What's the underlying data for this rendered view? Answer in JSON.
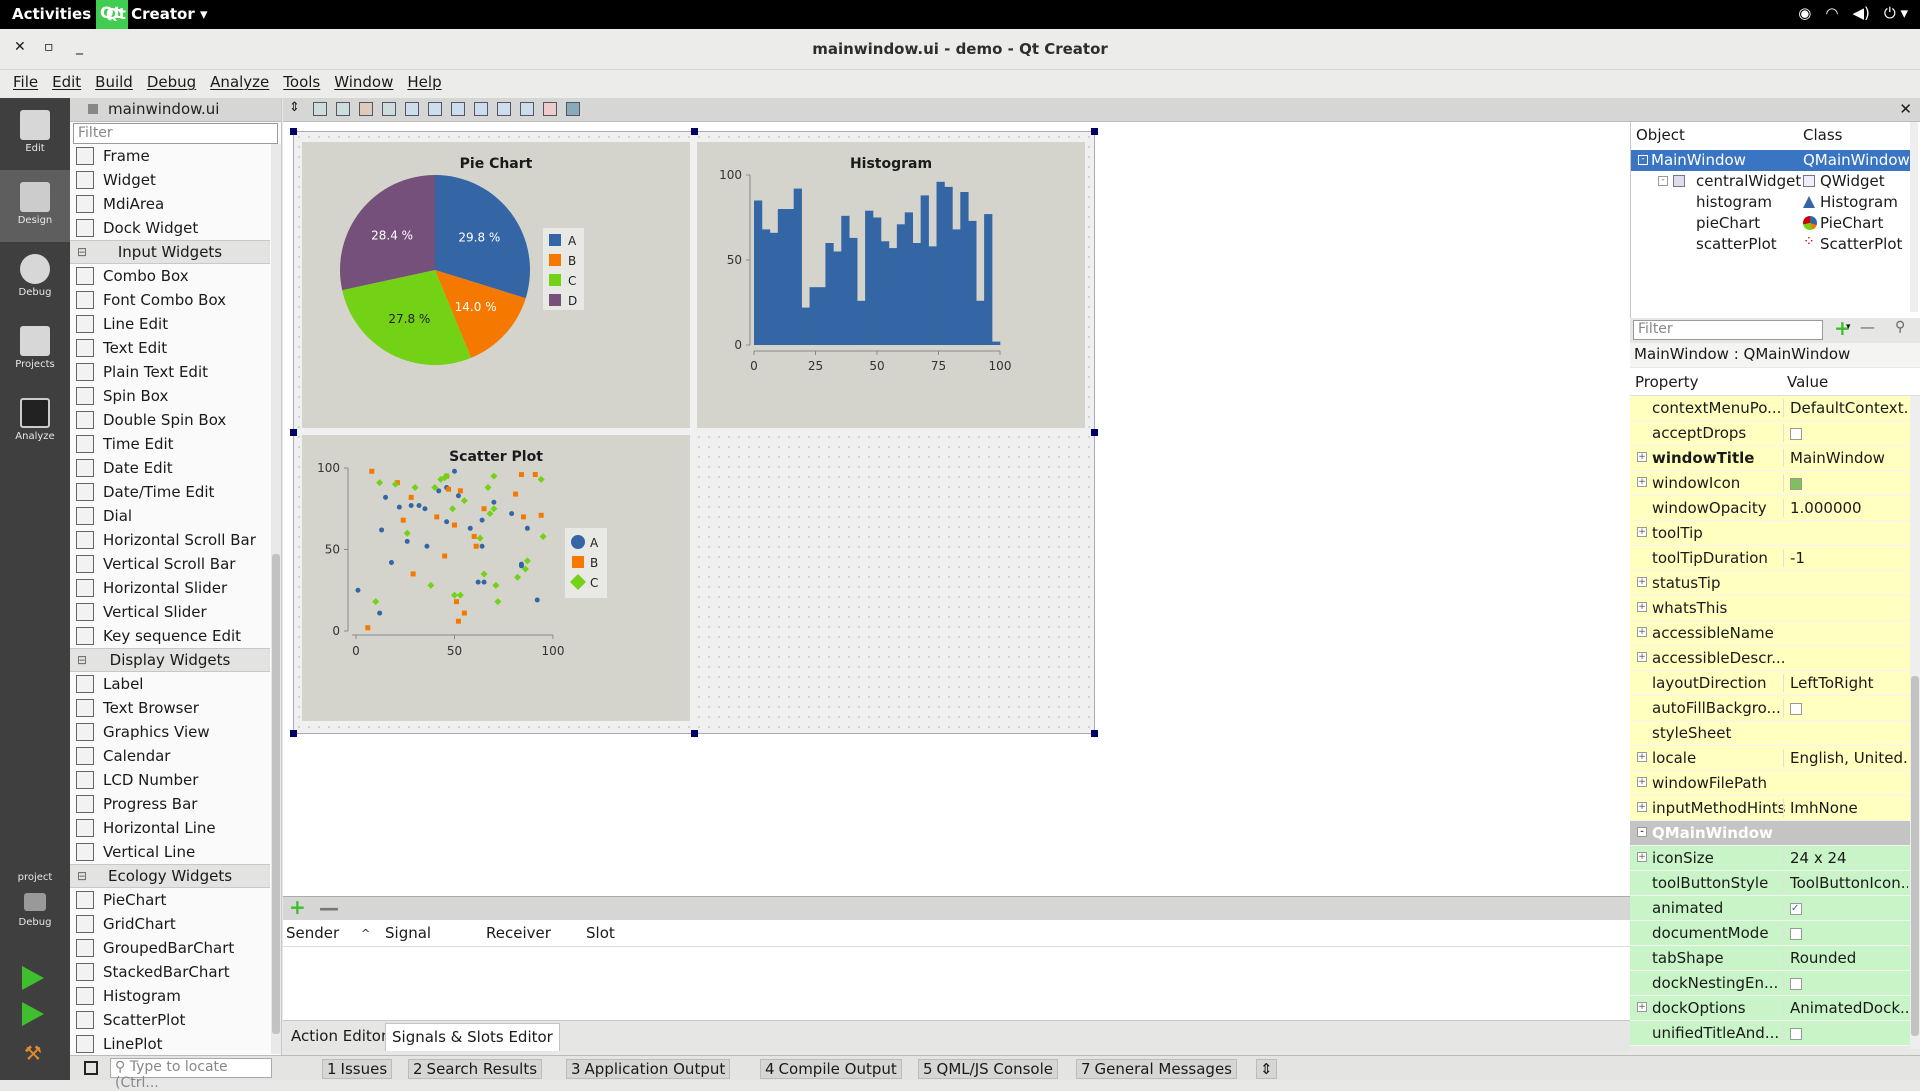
{
  "topbar": {
    "activities": "Activities",
    "app": "Qt Creator"
  },
  "window": {
    "title": "mainwindow.ui - demo - Qt Creator"
  },
  "menu": [
    "File",
    "Edit",
    "Build",
    "Debug",
    "Analyze",
    "Tools",
    "Window",
    "Help"
  ],
  "modes": [
    {
      "label": "Edit"
    },
    {
      "label": "Design"
    },
    {
      "label": "Debug"
    },
    {
      "label": "Projects"
    },
    {
      "label": "Analyze"
    }
  ],
  "kit": {
    "project": "project",
    "debug": "Debug"
  },
  "editor": {
    "file": "mainwindow.ui"
  },
  "widgetbox": {
    "filter_placeholder": "Filter",
    "groups": [
      {
        "name": "",
        "items": [
          "Frame",
          "Widget",
          "MdiArea",
          "Dock Widget"
        ]
      },
      {
        "name": "Input Widgets",
        "items": [
          "Combo Box",
          "Font Combo Box",
          "Line Edit",
          "Text Edit",
          "Plain Text Edit",
          "Spin Box",
          "Double Spin Box",
          "Time Edit",
          "Date Edit",
          "Date/Time Edit",
          "Dial",
          "Horizontal Scroll Bar",
          "Vertical Scroll Bar",
          "Horizontal Slider",
          "Vertical Slider",
          "Key sequence Edit"
        ]
      },
      {
        "name": "Display Widgets",
        "items": [
          "Label",
          "Text Browser",
          "Graphics View",
          "Calendar",
          "LCD Number",
          "Progress Bar",
          "Horizontal Line",
          "Vertical Line"
        ]
      },
      {
        "name": "Ecology Widgets",
        "items": [
          "PieChart",
          "GridChart",
          "GroupedBarChart",
          "StackedBarChart",
          "Histogram",
          "ScatterPlot",
          "LinePlot"
        ]
      }
    ]
  },
  "chart_data": [
    {
      "type": "pie",
      "title": "Pie Chart",
      "categories": [
        "A",
        "B",
        "C",
        "D"
      ],
      "values": [
        29.8,
        14.0,
        27.8,
        28.4
      ],
      "labels": [
        "29.8 %",
        "14.0 %",
        "27.8 %",
        "28.4 %"
      ],
      "colors": [
        "#3465a4",
        "#f57900",
        "#73d216",
        "#75507b"
      ]
    },
    {
      "type": "bar",
      "title": "Histogram",
      "xlim": [
        0,
        100
      ],
      "ylim": [
        0,
        100
      ],
      "xticks": [
        "0",
        "25",
        "50",
        "75",
        "100"
      ],
      "yticks": [
        "0",
        "50",
        "100"
      ],
      "values": [
        85,
        68,
        66,
        80,
        80,
        92,
        22,
        34,
        34,
        60,
        55,
        76,
        63,
        26,
        79,
        75,
        61,
        57,
        71,
        78,
        60,
        88,
        58,
        96,
        93,
        68,
        90,
        73,
        26,
        77,
        2
      ],
      "color": "#3465a4"
    },
    {
      "type": "scatter",
      "title": "Scatter Plot",
      "xlim": [
        0,
        100
      ],
      "ylim": [
        0,
        100
      ],
      "xticks": [
        "0",
        "50",
        "100"
      ],
      "yticks": [
        "0",
        "50",
        "100"
      ],
      "series": [
        {
          "name": "A",
          "color": "#3465a4",
          "shape": "circle",
          "points": [
            [
              1,
              25
            ],
            [
              12,
              11
            ],
            [
              13,
              62
            ],
            [
              15,
              82
            ],
            [
              18,
              42
            ],
            [
              22,
              76
            ],
            [
              26,
              55
            ],
            [
              28,
              77
            ],
            [
              32,
              77
            ],
            [
              35,
              75
            ],
            [
              36,
              52
            ],
            [
              42,
              86
            ],
            [
              46,
              88
            ],
            [
              46,
              67
            ],
            [
              50,
              98
            ],
            [
              52,
              83
            ],
            [
              58,
              63
            ],
            [
              62,
              30
            ],
            [
              64,
              52
            ],
            [
              64,
              68
            ],
            [
              65,
              30
            ],
            [
              70,
              79
            ],
            [
              79,
              72
            ],
            [
              84,
              40
            ],
            [
              84,
              41
            ],
            [
              87,
              63
            ],
            [
              92,
              19
            ]
          ]
        },
        {
          "name": "B",
          "color": "#f57900",
          "shape": "square",
          "points": [
            [
              6,
              2
            ],
            [
              8,
              98
            ],
            [
              21,
              91
            ],
            [
              24,
              68
            ],
            [
              28,
              82
            ],
            [
              29,
              35
            ],
            [
              41,
              70
            ],
            [
              45,
              46
            ],
            [
              46,
              95
            ],
            [
              47,
              87
            ],
            [
              50,
              65
            ],
            [
              51,
              18
            ],
            [
              52,
              6
            ],
            [
              53,
              86
            ],
            [
              55,
              11
            ],
            [
              60,
              58
            ],
            [
              61,
              52
            ],
            [
              65,
              75
            ],
            [
              81,
              84
            ],
            [
              84,
              96
            ],
            [
              85,
              70
            ],
            [
              91,
              96
            ],
            [
              94,
              71
            ]
          ]
        },
        {
          "name": "C",
          "color": "#73d216",
          "shape": "diamond",
          "points": [
            [
              10,
              18
            ],
            [
              12,
              91
            ],
            [
              20,
              90
            ],
            [
              26,
              60
            ],
            [
              30,
              88
            ],
            [
              38,
              28
            ],
            [
              40,
              88
            ],
            [
              43,
              93
            ],
            [
              45,
              94
            ],
            [
              46,
              95
            ],
            [
              49,
              75
            ],
            [
              50,
              22
            ],
            [
              53,
              22
            ],
            [
              55,
              80
            ],
            [
              63,
              57
            ],
            [
              65,
              35
            ],
            [
              67,
              88
            ],
            [
              68,
              72
            ],
            [
              70,
              95
            ],
            [
              70,
              75
            ],
            [
              71,
              28
            ],
            [
              72,
              18
            ],
            [
              82,
              33
            ],
            [
              86,
              38
            ],
            [
              87,
              43
            ],
            [
              94,
              93
            ],
            [
              95,
              58
            ]
          ]
        }
      ]
    }
  ],
  "signals": {
    "columns": [
      "Sender",
      "Signal",
      "Receiver",
      "Slot"
    ],
    "tabs": [
      "Action Editor",
      "Signals & Slots Editor"
    ]
  },
  "objects": {
    "headers": [
      "Object",
      "Class"
    ],
    "rows": [
      {
        "name": "MainWindow",
        "cls": "QMainWindow"
      },
      {
        "name": "centralWidget",
        "cls": "QWidget"
      },
      {
        "name": "histogram",
        "cls": "Histogram"
      },
      {
        "name": "pieChart",
        "cls": "PieChart"
      },
      {
        "name": "scatterPlot",
        "cls": "ScatterPlot"
      }
    ]
  },
  "properties": {
    "filter_placeholder": "Filter",
    "class_line": "MainWindow : QMainWindow",
    "headers": [
      "Property",
      "Value"
    ],
    "rows": [
      {
        "name": "contextMenuPo...",
        "value": "DefaultContext...",
        "bg": "y",
        "exp": false,
        "bold": false,
        "check": false
      },
      {
        "name": "acceptDrops",
        "value": "",
        "bg": "y",
        "exp": false,
        "bold": false,
        "check": true
      },
      {
        "name": "windowTitle",
        "value": "MainWindow",
        "bg": "y",
        "exp": true,
        "bold": true,
        "check": false
      },
      {
        "name": "windowIcon",
        "value": "",
        "bg": "y",
        "exp": true,
        "bold": false,
        "check": false
      },
      {
        "name": "windowOpacity",
        "value": "1.000000",
        "bg": "y",
        "exp": false,
        "bold": false,
        "check": false
      },
      {
        "name": "toolTip",
        "value": "",
        "bg": "y",
        "exp": true,
        "bold": false,
        "check": false
      },
      {
        "name": "toolTipDuration",
        "value": "-1",
        "bg": "y",
        "exp": false,
        "bold": false,
        "check": false
      },
      {
        "name": "statusTip",
        "value": "",
        "bg": "y",
        "exp": true,
        "bold": false,
        "check": false
      },
      {
        "name": "whatsThis",
        "value": "",
        "bg": "y",
        "exp": true,
        "bold": false,
        "check": false
      },
      {
        "name": "accessibleName",
        "value": "",
        "bg": "y",
        "exp": true,
        "bold": false,
        "check": false
      },
      {
        "name": "accessibleDescr...",
        "value": "",
        "bg": "y",
        "exp": true,
        "bold": false,
        "check": false
      },
      {
        "name": "layoutDirection",
        "value": "LeftToRight",
        "bg": "y",
        "exp": false,
        "bold": false,
        "check": false
      },
      {
        "name": "autoFillBackgro...",
        "value": "",
        "bg": "y",
        "exp": false,
        "bold": false,
        "check": true
      },
      {
        "name": "styleSheet",
        "value": "",
        "bg": "y",
        "exp": false,
        "bold": false,
        "check": false
      },
      {
        "name": "locale",
        "value": "English, United...",
        "bg": "y",
        "exp": true,
        "bold": false,
        "check": false
      },
      {
        "name": "windowFilePath",
        "value": "",
        "bg": "y",
        "exp": true,
        "bold": false,
        "check": false
      },
      {
        "name": "inputMethodHints",
        "value": "ImhNone",
        "bg": "y",
        "exp": true,
        "bold": false,
        "check": false
      },
      {
        "name": "QMainWindow",
        "value": "",
        "bg": "sec",
        "exp": true,
        "bold": true,
        "check": false
      },
      {
        "name": "iconSize",
        "value": "24 x 24",
        "bg": "g",
        "exp": true,
        "bold": false,
        "check": false
      },
      {
        "name": "toolButtonStyle",
        "value": "ToolButtonIcon...",
        "bg": "g",
        "exp": false,
        "bold": false,
        "check": false
      },
      {
        "name": "animated",
        "value": "",
        "bg": "g",
        "exp": false,
        "bold": false,
        "check": true,
        "checked": true
      },
      {
        "name": "documentMode",
        "value": "",
        "bg": "g",
        "exp": false,
        "bold": false,
        "check": true
      },
      {
        "name": "tabShape",
        "value": "Rounded",
        "bg": "g",
        "exp": false,
        "bold": false,
        "check": false
      },
      {
        "name": "dockNestingEn...",
        "value": "",
        "bg": "g",
        "exp": false,
        "bold": false,
        "check": true
      },
      {
        "name": "dockOptions",
        "value": "AnimatedDock...",
        "bg": "g",
        "exp": true,
        "bold": false,
        "check": false
      },
      {
        "name": "unifiedTitleAnd...",
        "value": "",
        "bg": "g",
        "exp": false,
        "bold": false,
        "check": true
      }
    ]
  },
  "statusbar": {
    "locate_placeholder": "Type to locate (Ctrl...",
    "panes": [
      {
        "num": "1",
        "label": "Issues"
      },
      {
        "num": "2",
        "label": "Search Results"
      },
      {
        "num": "3",
        "label": "Application Output"
      },
      {
        "num": "4",
        "label": "Compile Output"
      },
      {
        "num": "5",
        "label": "QML/JS Console"
      },
      {
        "num": "7",
        "label": "General Messages"
      }
    ]
  }
}
